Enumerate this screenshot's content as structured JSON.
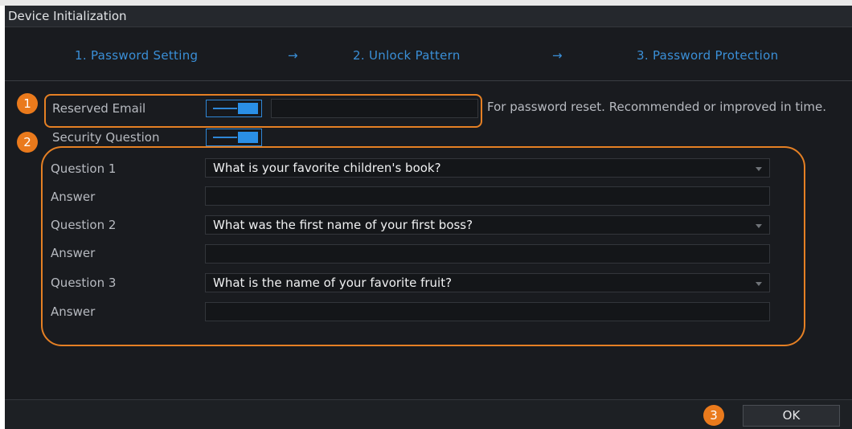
{
  "window": {
    "title": "Device Initialization"
  },
  "steps": {
    "step1": "1. Password Setting",
    "arrow1": "→",
    "step2": "2. Unlock Pattern",
    "arrow2": "→",
    "step3": "3. Password Protection"
  },
  "email": {
    "label": "Reserved Email",
    "value": "",
    "toggle_on": true
  },
  "hint": "For password reset. Recommended or improved in time.",
  "security": {
    "label": "Security Question",
    "toggle_on": true
  },
  "questions": [
    {
      "label": "Question 1",
      "selected": "What is your favorite children's book?",
      "answer_label": "Answer",
      "answer": ""
    },
    {
      "label": "Question 2",
      "selected": "What was the first name of your first boss?",
      "answer_label": "Answer",
      "answer": ""
    },
    {
      "label": "Question 3",
      "selected": "What is the name of your favorite fruit?",
      "answer_label": "Answer",
      "answer": ""
    }
  ],
  "badges": [
    "1",
    "2",
    "3"
  ],
  "ok_label": "OK",
  "colors": {
    "accent": "#2a8fe6",
    "highlight": "#e58024",
    "step_text": "#3a8fd7",
    "background": "#191b1f"
  }
}
